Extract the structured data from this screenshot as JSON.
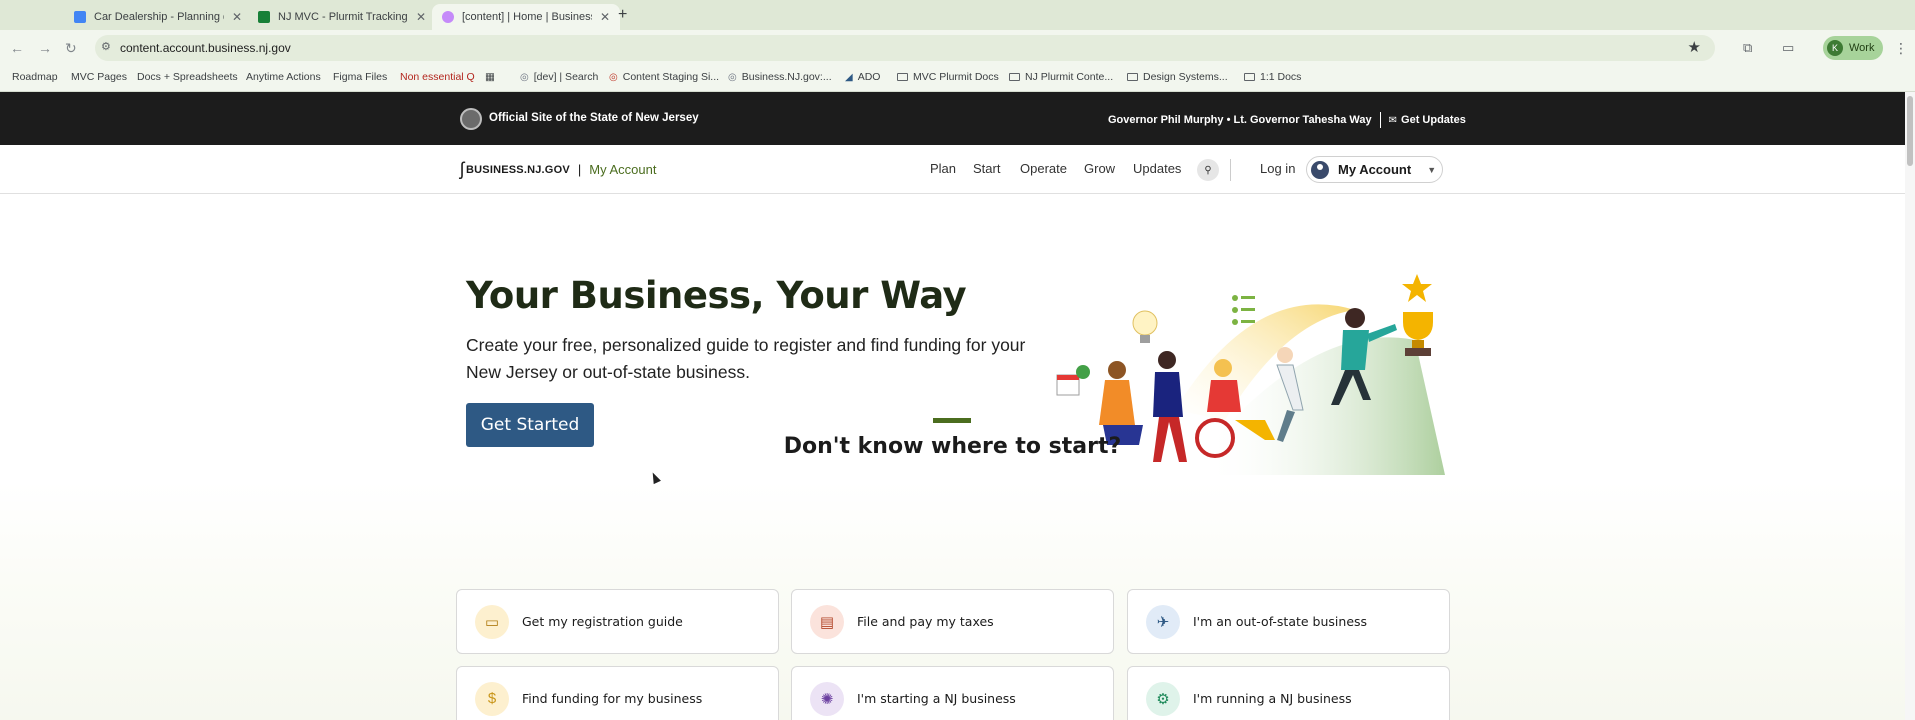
{
  "browser": {
    "tabs": [
      {
        "title": "Car Dealership - Planning doc",
        "favicon_color": "#4285f4",
        "active": false
      },
      {
        "title": "NJ MVC - Plurmit Tracking - ",
        "favicon_color": "#188038",
        "active": false
      },
      {
        "title": "[content] | Home | Business.N",
        "favicon_color": "#c58af9",
        "active": true
      }
    ],
    "new_tab": "+",
    "close_glyph": "✕",
    "url": "content.account.business.nj.gov",
    "profile_label": "Work",
    "profile_initial": "K",
    "bookmarks": [
      {
        "label": "Roadmap",
        "kind": "text"
      },
      {
        "label": "MVC Pages",
        "kind": "text"
      },
      {
        "label": "Docs + Spreadsheets",
        "kind": "text"
      },
      {
        "label": "Anytime Actions",
        "kind": "text"
      },
      {
        "label": "Figma Files",
        "kind": "text"
      },
      {
        "label": "Non essential Q",
        "kind": "text"
      },
      {
        "label": "[dev] | Search",
        "kind": "site"
      },
      {
        "label": "Content Staging Si...",
        "kind": "site"
      },
      {
        "label": "Business.NJ.gov:...",
        "kind": "site"
      },
      {
        "label": "ADO",
        "kind": "site"
      },
      {
        "label": "MVC Plurmit Docs",
        "kind": "folder"
      },
      {
        "label": "NJ Plurmit Conte...",
        "kind": "folder"
      },
      {
        "label": "Design Systems...",
        "kind": "folder"
      },
      {
        "label": "1:1 Docs",
        "kind": "folder"
      }
    ]
  },
  "govbar": {
    "official": "Official Site of the State of New Jersey",
    "governor": "Governor Phil Murphy • Lt. Governor Tahesha Way",
    "updates": "Get Updates"
  },
  "header": {
    "brand": "BUSINESS.NJ.GOV",
    "brand_sub": "My Account",
    "nav": [
      "Plan",
      "Start",
      "Operate",
      "Grow",
      "Updates"
    ],
    "login": "Log in",
    "account": "My Account"
  },
  "hero": {
    "title": "Your Business, Your Way",
    "subtitle": "Create your free, personalized guide to register and find funding for your New Jersey or out-of-state business.",
    "cta": "Get Started"
  },
  "section": {
    "title": "Don't know where to start?",
    "cards": [
      {
        "label": "Get my registration guide",
        "icon": "briefcase-icon",
        "bg": "#fdf0cf",
        "fg": "#b07d14"
      },
      {
        "label": "File and pay my taxes",
        "icon": "receipt-icon",
        "bg": "#fbe3dc",
        "fg": "#b3472a"
      },
      {
        "label": "I'm an out-of-state business",
        "icon": "airplane-icon",
        "bg": "#e1ebf7",
        "fg": "#2e5984"
      },
      {
        "label": "Find funding for my business",
        "icon": "dollar-icon",
        "bg": "#fdf0cf",
        "fg": "#c9961a"
      },
      {
        "label": "I'm starting a NJ business",
        "icon": "lightbulb-icon",
        "bg": "#ece3f5",
        "fg": "#6b3fa0"
      },
      {
        "label": "I'm running a NJ business",
        "icon": "gear-icon",
        "bg": "#dff3ea",
        "fg": "#1e8a5a"
      }
    ]
  }
}
